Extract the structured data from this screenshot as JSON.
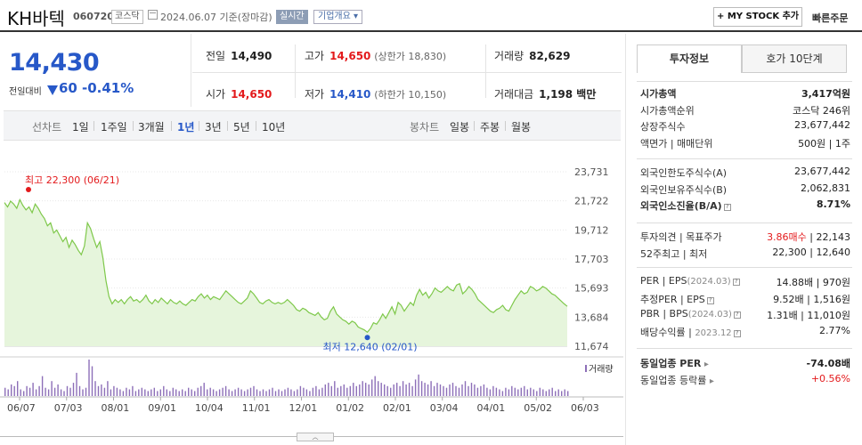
{
  "header": {
    "company": "KH바텍",
    "code": "060720",
    "market": "코스닥",
    "date": "2024.06.07 기준(장마감)",
    "realtime": "실시간",
    "overview": "기업개요 ▾",
    "mystock": "+ MY STOCK 추가",
    "quick_order": "빠른주문"
  },
  "price": {
    "current": "14,430",
    "change_label": "전일대비",
    "change": "60",
    "change_pct": "-0.41%",
    "colors": {
      "down": "#2758c8",
      "up": "#e31a1c"
    }
  },
  "stats": {
    "prev_label": "전일",
    "prev": "14,490",
    "high_label": "고가",
    "high": "14,650",
    "upper_limit": "(상한가 18,830)",
    "vol_label": "거래량",
    "vol": "82,629",
    "open_label": "시가",
    "open": "14,650",
    "low_label": "저가",
    "low": "14,410",
    "lower_limit": "(하한가 10,150)",
    "amt_label": "거래대금",
    "amt": "1,198 백만"
  },
  "periods": {
    "line_label": "선차트",
    "items": [
      "1일",
      "1주일",
      "3개월",
      "1년",
      "3년",
      "5년",
      "10년"
    ],
    "selected": "1년",
    "candle_label": "봉차트",
    "candle_items": [
      "일봉",
      "주봉",
      "월봉"
    ]
  },
  "chart_data": {
    "type": "area",
    "y_ticks": [
      "23,731",
      "21,722",
      "19,712",
      "17,703",
      "15,693",
      "13,684",
      "11,674"
    ],
    "ylim": [
      11674,
      23731
    ],
    "x_ticks": [
      "06/07",
      "07/03",
      "08/01",
      "09/01",
      "10/04",
      "11/01",
      "12/01",
      "01/02",
      "02/01",
      "03/04",
      "04/01",
      "05/02",
      "06/03"
    ],
    "high_label": "최고 22,300 (06/21)",
    "low_label": "최저 12,640 (02/01)",
    "volume_label": "거래량",
    "colors": {
      "line": "#7ec84a",
      "fill": "#e6f5dc",
      "volume": "#8d6fb8",
      "high": "#e31a1c",
      "low": "#2758c8"
    },
    "values": [
      21600,
      21300,
      21700,
      21500,
      21200,
      21800,
      21400,
      21100,
      21300,
      20900,
      21500,
      21200,
      20800,
      20500,
      20000,
      20200,
      19500,
      19700,
      19300,
      18900,
      19200,
      18500,
      19000,
      18700,
      18300,
      18000,
      18600,
      20200,
      19800,
      19100,
      18500,
      18900,
      17800,
      16200,
      15100,
      14600,
      14900,
      14700,
      14900,
      14600,
      14900,
      15100,
      14800,
      14900,
      14700,
      14900,
      15200,
      14800,
      14600,
      14900,
      14700,
      15000,
      14800,
      14600,
      14900,
      14700,
      14600,
      14800,
      14600,
      14500,
      14700,
      14900,
      14800,
      15100,
      15300,
      15000,
      15200,
      14900,
      15100,
      15000,
      14900,
      15200,
      15500,
      15300,
      15100,
      14900,
      14700,
      14600,
      14800,
      15000,
      15500,
      15300,
      15000,
      14700,
      14600,
      14800,
      14900,
      14700,
      14600,
      14700,
      14600,
      14700,
      14900,
      14700,
      14500,
      14200,
      14100,
      14300,
      14200,
      14000,
      13900,
      13800,
      14000,
      13700,
      13500,
      13600,
      14100,
      14400,
      13900,
      13700,
      13500,
      13400,
      13200,
      13400,
      13300,
      13000,
      12900,
      12800,
      12640,
      12900,
      13300,
      13200,
      13500,
      13900,
      13600,
      14000,
      14400,
      13900,
      14700,
      14500,
      14100,
      14400,
      14700,
      14500,
      15200,
      15600,
      15200,
      15400,
      15000,
      15300,
      15700,
      15500,
      15400,
      15600,
      15800,
      15600,
      15500,
      15900,
      16000,
      15300,
      15500,
      15800,
      15600,
      15300,
      14900,
      14700,
      14500,
      14300,
      14100,
      14000,
      14200,
      14300,
      14500,
      14200,
      14100,
      14500,
      14900,
      15200,
      15500,
      15300,
      15400,
      15800,
      15700,
      15500,
      15600,
      15800,
      15700,
      15500,
      15300,
      15200,
      15000,
      14800,
      14600,
      14430
    ],
    "volumes": [
      5,
      4,
      7,
      6,
      9,
      4,
      3,
      6,
      5,
      8,
      4,
      6,
      12,
      5,
      4,
      9,
      5,
      7,
      4,
      3,
      6,
      5,
      8,
      14,
      6,
      4,
      5,
      22,
      18,
      9,
      6,
      7,
      5,
      9,
      4,
      6,
      5,
      4,
      3,
      5,
      4,
      6,
      3,
      4,
      5,
      4,
      3,
      4,
      5,
      3,
      4,
      6,
      4,
      3,
      5,
      4,
      3,
      4,
      3,
      5,
      4,
      3,
      5,
      6,
      8,
      4,
      5,
      4,
      3,
      4,
      5,
      6,
      4,
      3,
      4,
      5,
      4,
      3,
      4,
      5,
      6,
      4,
      3,
      4,
      3,
      4,
      5,
      3,
      4,
      3,
      4,
      5,
      4,
      3,
      4,
      6,
      5,
      4,
      3,
      5,
      6,
      4,
      5,
      7,
      8,
      6,
      9,
      5,
      6,
      7,
      5,
      6,
      8,
      6,
      7,
      9,
      8,
      7,
      10,
      12,
      9,
      8,
      7,
      6,
      5,
      7,
      8,
      6,
      9,
      7,
      8,
      6,
      10,
      13,
      9,
      8,
      7,
      9,
      6,
      8,
      7,
      6,
      5,
      7,
      8,
      6,
      5,
      7,
      9,
      6,
      8,
      7,
      5,
      6,
      7,
      5,
      4,
      6,
      5,
      4,
      3,
      5,
      4,
      6,
      5,
      4,
      5,
      6,
      4,
      5,
      4,
      3,
      5,
      4,
      3,
      4,
      5,
      3,
      4,
      3,
      4,
      3
    ]
  },
  "panel": {
    "tab_active": "투자정보",
    "tab_inactive": "호가 10단계",
    "g1": [
      {
        "k": "시가총액",
        "v": "3,417억원",
        "bold": true
      },
      {
        "k": "시가총액순위",
        "v": "코스닥 246위"
      },
      {
        "k": "상장주식수",
        "v": "23,677,442"
      },
      {
        "k": "액면가 | 매매단위",
        "v": "500원 | 1주"
      }
    ],
    "g2": [
      {
        "k": "외국인한도주식수(A)",
        "v": "23,677,442"
      },
      {
        "k": "외국인보유주식수(B)",
        "v": "2,062,831"
      },
      {
        "k": "외국인소진율(B/A)",
        "v": "8.71%",
        "bold": true,
        "q": true
      }
    ],
    "g3": [
      {
        "k": "투자의견 | 목표주가",
        "v1": "3.86매수",
        "v2": "| 22,143"
      },
      {
        "k": "52주최고 | 최저",
        "v": "22,300 | 12,640"
      }
    ],
    "g4": [
      {
        "k": "PER | EPS",
        "sub": "(2024.03)",
        "v": "14.88배 | 970원",
        "q": true
      },
      {
        "k": "추정PER | EPS",
        "v": "9.52배 | 1,516원",
        "q": true
      },
      {
        "k": "PBR | BPS",
        "sub": "(2024.03)",
        "v": "1.31배 | 11,010원",
        "q": true
      },
      {
        "k": "배당수익률 | ",
        "sub": "2023.12",
        "v": "2.77%",
        "q": true
      }
    ],
    "g5": [
      {
        "k": "동일업종 PER",
        "v": "-74.08배",
        "bold": true
      },
      {
        "k": "동일업종 등락률",
        "v": "+0.56%",
        "red": true
      }
    ]
  }
}
